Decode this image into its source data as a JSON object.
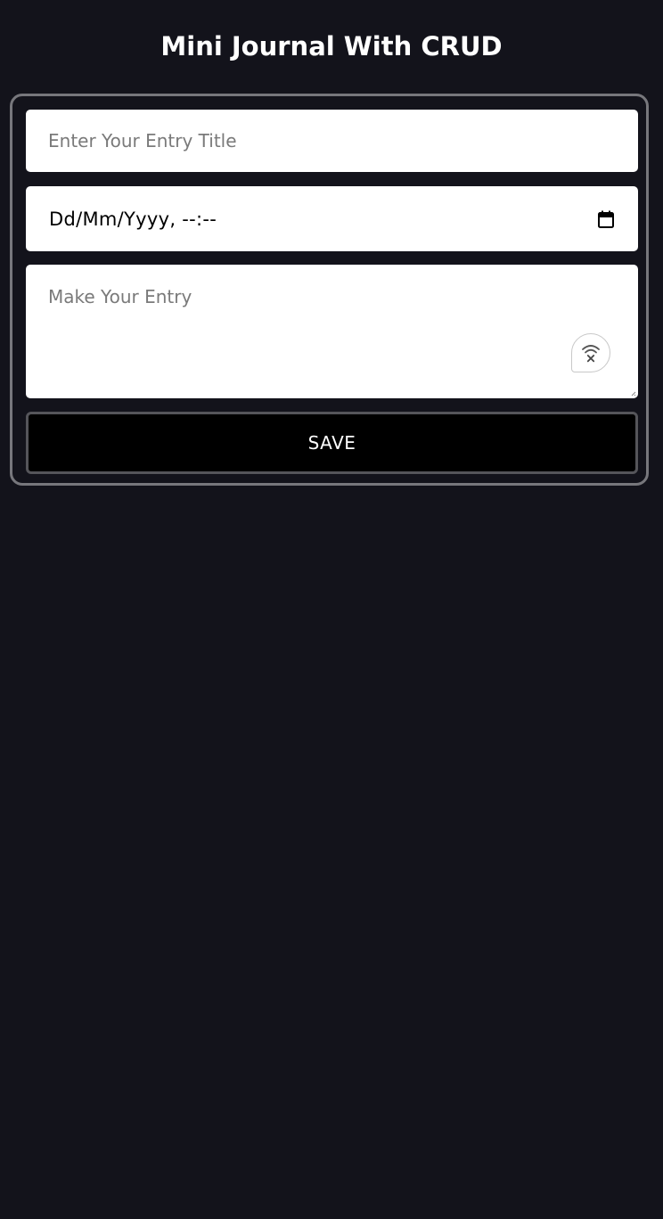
{
  "header": {
    "title": "Mini Journal With CRUD"
  },
  "form": {
    "title_input": {
      "placeholder": "Enter Your Entry Title",
      "value": ""
    },
    "date_input": {
      "value": "Dd/Mm/Yyyy, --:--",
      "icon": "calendar-icon"
    },
    "entry_input": {
      "placeholder": "Make Your Entry",
      "value": "",
      "assist_icon": "voice-assist-icon"
    },
    "save_label": "SAVE"
  },
  "colors": {
    "background": "#13131b",
    "card_border": "#77777c",
    "field_background": "#ffffff",
    "placeholder": "#7a7a7a",
    "button_background": "#000000",
    "button_border": "#55555a",
    "text_light": "#ffffff"
  }
}
